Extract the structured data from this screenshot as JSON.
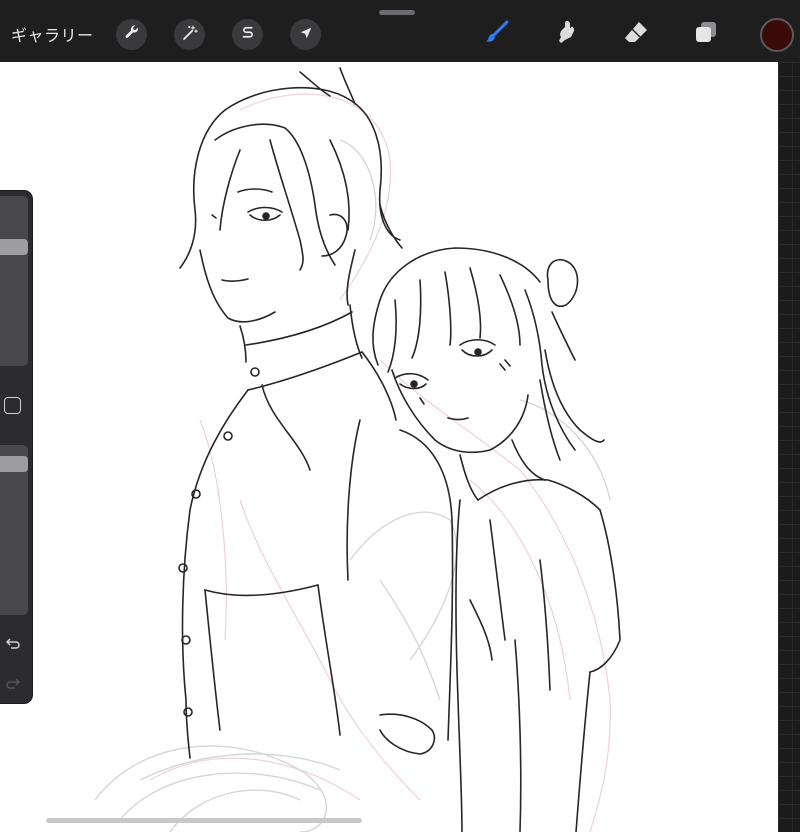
{
  "toolbar": {
    "gallery_label": "ギャラリー",
    "left_tools": [
      {
        "name": "actions",
        "icon": "wrench-icon"
      },
      {
        "name": "adjustments",
        "icon": "magic-wand-icon"
      },
      {
        "name": "selection",
        "icon": "selection-s-icon"
      },
      {
        "name": "transform",
        "icon": "arrow-cursor-icon"
      }
    ],
    "right_tools": [
      {
        "name": "brush",
        "icon": "brush-icon",
        "active": true
      },
      {
        "name": "smudge",
        "icon": "smudge-icon",
        "active": false
      },
      {
        "name": "eraser",
        "icon": "eraser-icon",
        "active": false
      },
      {
        "name": "layers",
        "icon": "layers-icon",
        "active": false
      }
    ],
    "current_color": "#3a0a08",
    "active_tool_color": "#2f7cf6"
  },
  "sidebar": {
    "brush_size_level": 0.72,
    "opacity_level": 0.93,
    "icons": [
      "modify-square-icon",
      "undo-icon",
      "redo-icon"
    ]
  }
}
